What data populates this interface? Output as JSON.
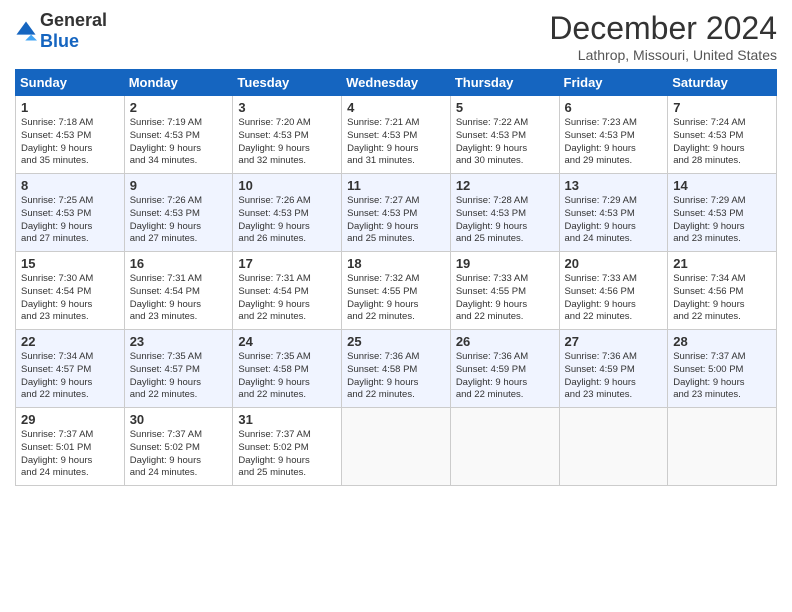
{
  "logo": {
    "general": "General",
    "blue": "Blue"
  },
  "title": "December 2024",
  "subtitle": "Lathrop, Missouri, United States",
  "days_of_week": [
    "Sunday",
    "Monday",
    "Tuesday",
    "Wednesday",
    "Thursday",
    "Friday",
    "Saturday"
  ],
  "weeks": [
    [
      {
        "day": "1",
        "sunrise": "7:18 AM",
        "sunset": "4:53 PM",
        "daylight": "9 hours and 35 minutes."
      },
      {
        "day": "2",
        "sunrise": "7:19 AM",
        "sunset": "4:53 PM",
        "daylight": "9 hours and 34 minutes."
      },
      {
        "day": "3",
        "sunrise": "7:20 AM",
        "sunset": "4:53 PM",
        "daylight": "9 hours and 32 minutes."
      },
      {
        "day": "4",
        "sunrise": "7:21 AM",
        "sunset": "4:53 PM",
        "daylight": "9 hours and 31 minutes."
      },
      {
        "day": "5",
        "sunrise": "7:22 AM",
        "sunset": "4:53 PM",
        "daylight": "9 hours and 30 minutes."
      },
      {
        "day": "6",
        "sunrise": "7:23 AM",
        "sunset": "4:53 PM",
        "daylight": "9 hours and 29 minutes."
      },
      {
        "day": "7",
        "sunrise": "7:24 AM",
        "sunset": "4:53 PM",
        "daylight": "9 hours and 28 minutes."
      }
    ],
    [
      {
        "day": "8",
        "sunrise": "7:25 AM",
        "sunset": "4:53 PM",
        "daylight": "9 hours and 27 minutes."
      },
      {
        "day": "9",
        "sunrise": "7:26 AM",
        "sunset": "4:53 PM",
        "daylight": "9 hours and 27 minutes."
      },
      {
        "day": "10",
        "sunrise": "7:26 AM",
        "sunset": "4:53 PM",
        "daylight": "9 hours and 26 minutes."
      },
      {
        "day": "11",
        "sunrise": "7:27 AM",
        "sunset": "4:53 PM",
        "daylight": "9 hours and 25 minutes."
      },
      {
        "day": "12",
        "sunrise": "7:28 AM",
        "sunset": "4:53 PM",
        "daylight": "9 hours and 25 minutes."
      },
      {
        "day": "13",
        "sunrise": "7:29 AM",
        "sunset": "4:53 PM",
        "daylight": "9 hours and 24 minutes."
      },
      {
        "day": "14",
        "sunrise": "7:29 AM",
        "sunset": "4:53 PM",
        "daylight": "9 hours and 23 minutes."
      }
    ],
    [
      {
        "day": "15",
        "sunrise": "7:30 AM",
        "sunset": "4:54 PM",
        "daylight": "9 hours and 23 minutes."
      },
      {
        "day": "16",
        "sunrise": "7:31 AM",
        "sunset": "4:54 PM",
        "daylight": "9 hours and 23 minutes."
      },
      {
        "day": "17",
        "sunrise": "7:31 AM",
        "sunset": "4:54 PM",
        "daylight": "9 hours and 22 minutes."
      },
      {
        "day": "18",
        "sunrise": "7:32 AM",
        "sunset": "4:55 PM",
        "daylight": "9 hours and 22 minutes."
      },
      {
        "day": "19",
        "sunrise": "7:33 AM",
        "sunset": "4:55 PM",
        "daylight": "9 hours and 22 minutes."
      },
      {
        "day": "20",
        "sunrise": "7:33 AM",
        "sunset": "4:56 PM",
        "daylight": "9 hours and 22 minutes."
      },
      {
        "day": "21",
        "sunrise": "7:34 AM",
        "sunset": "4:56 PM",
        "daylight": "9 hours and 22 minutes."
      }
    ],
    [
      {
        "day": "22",
        "sunrise": "7:34 AM",
        "sunset": "4:57 PM",
        "daylight": "9 hours and 22 minutes."
      },
      {
        "day": "23",
        "sunrise": "7:35 AM",
        "sunset": "4:57 PM",
        "daylight": "9 hours and 22 minutes."
      },
      {
        "day": "24",
        "sunrise": "7:35 AM",
        "sunset": "4:58 PM",
        "daylight": "9 hours and 22 minutes."
      },
      {
        "day": "25",
        "sunrise": "7:36 AM",
        "sunset": "4:58 PM",
        "daylight": "9 hours and 22 minutes."
      },
      {
        "day": "26",
        "sunrise": "7:36 AM",
        "sunset": "4:59 PM",
        "daylight": "9 hours and 22 minutes."
      },
      {
        "day": "27",
        "sunrise": "7:36 AM",
        "sunset": "4:59 PM",
        "daylight": "9 hours and 23 minutes."
      },
      {
        "day": "28",
        "sunrise": "7:37 AM",
        "sunset": "5:00 PM",
        "daylight": "9 hours and 23 minutes."
      }
    ],
    [
      {
        "day": "29",
        "sunrise": "7:37 AM",
        "sunset": "5:01 PM",
        "daylight": "9 hours and 24 minutes."
      },
      {
        "day": "30",
        "sunrise": "7:37 AM",
        "sunset": "5:02 PM",
        "daylight": "9 hours and 24 minutes."
      },
      {
        "day": "31",
        "sunrise": "7:37 AM",
        "sunset": "5:02 PM",
        "daylight": "9 hours and 25 minutes."
      },
      null,
      null,
      null,
      null
    ]
  ],
  "labels": {
    "sunrise": "Sunrise:",
    "sunset": "Sunset:",
    "daylight": "Daylight:"
  }
}
